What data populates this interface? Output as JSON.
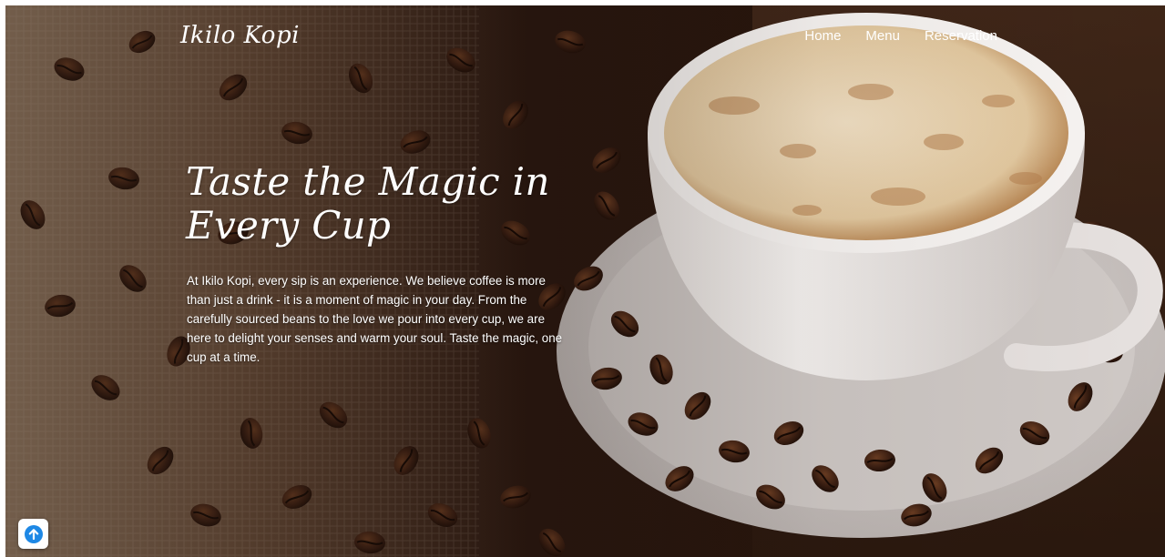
{
  "header": {
    "brand": "Ikilo Kopi",
    "nav": [
      {
        "label": "Home"
      },
      {
        "label": "Menu"
      },
      {
        "label": "Reservation"
      }
    ]
  },
  "hero": {
    "headline": "Taste the Magic in Every Cup",
    "paragraph": "At Ikilo Kopi, every sip is an experience. We believe coffee is more than just a drink - it is a moment of magic in your day. From the carefully sourced beans to the love we pour into every cup, we are here to delight your senses and warm your soul. Taste the magic, one cup at a time.",
    "background": "coffee-beans-and-cappuccino-photo"
  },
  "scroll_top": {
    "icon": "arrow-up-circle-icon"
  },
  "colors": {
    "text": "#ffffff",
    "beans": "#3b2114",
    "foam": "#e9d3b0",
    "cup": "#f3f0ee",
    "scroll_icon": "#1e88e5"
  }
}
